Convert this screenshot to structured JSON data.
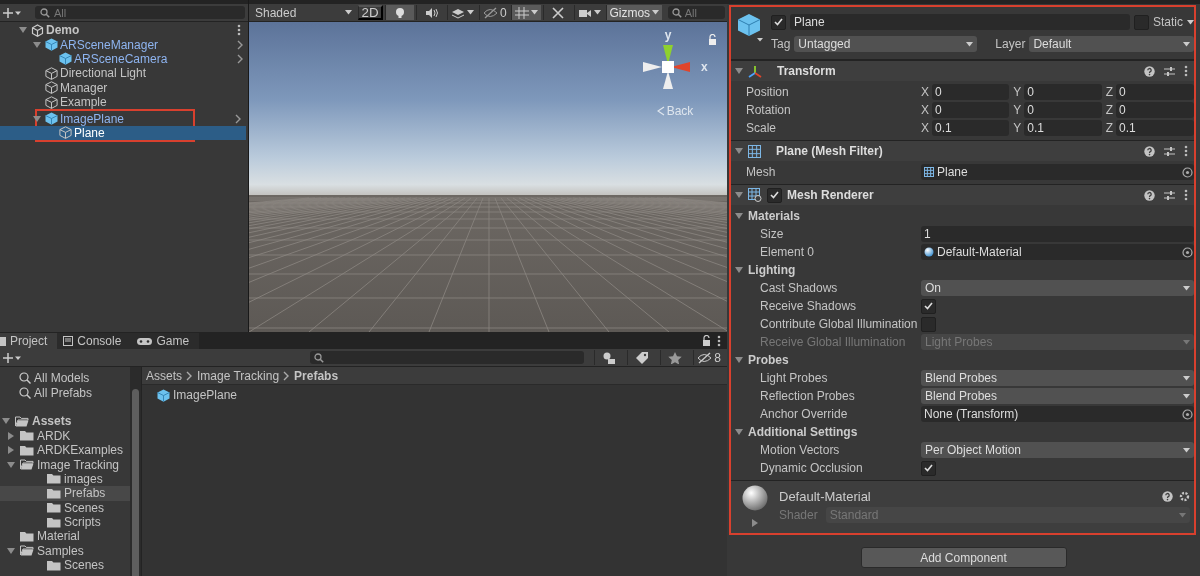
{
  "hierarchy": {
    "search_placeholder": "All",
    "items": [
      {
        "label": "Demo",
        "kind": "scene",
        "expanded": true,
        "selected": false,
        "highlighted": false,
        "children": [
          {
            "label": "ARSceneManager",
            "kind": "prefab",
            "expanded": true,
            "selected": false,
            "highlighted": false,
            "children": [
              {
                "label": "ARSceneCamera",
                "kind": "prefab",
                "selected": false,
                "highlighted": false
              }
            ]
          },
          {
            "label": "Directional Light",
            "kind": "object",
            "selected": false,
            "highlighted": false
          },
          {
            "label": "Manager",
            "kind": "object",
            "selected": false,
            "highlighted": false
          },
          {
            "label": "Example",
            "kind": "object",
            "selected": false,
            "highlighted": false
          },
          {
            "label": "ImagePlane",
            "kind": "prefab",
            "expanded": true,
            "selected": false,
            "highlighted": true,
            "children": [
              {
                "label": "Plane",
                "kind": "object",
                "selected": true,
                "highlighted": false
              }
            ]
          }
        ]
      }
    ]
  },
  "scene": {
    "toolbar": {
      "shading": "Shaded",
      "mode_2d": "2D",
      "lighting_on": true,
      "audio_on": false,
      "effects_on": false,
      "hidden_count": "0",
      "grid_on": true,
      "tools_on": false,
      "gizmos": "Gizmos",
      "search_placeholder": "All"
    },
    "gizmo": {
      "y_label": "y",
      "x_label": "x",
      "back_label": "Back"
    }
  },
  "project": {
    "tabs": [
      {
        "label": "Project",
        "kind": "project",
        "selected": true
      },
      {
        "label": "Console",
        "kind": "console",
        "selected": false
      },
      {
        "label": "Game",
        "kind": "game",
        "selected": false
      }
    ],
    "hidden_count": "8",
    "favorites": [
      "All Models",
      "All Prefabs"
    ],
    "folders": [
      {
        "label": "Assets",
        "expanded": true,
        "selected": false,
        "children": [
          {
            "label": "ARDK",
            "expanded": false,
            "selected": false
          },
          {
            "label": "ARDKExamples",
            "expanded": false,
            "selected": false
          },
          {
            "label": "Image Tracking",
            "expanded": true,
            "selected": false,
            "children": [
              {
                "label": "images",
                "selected": false
              },
              {
                "label": "Prefabs",
                "selected": true
              },
              {
                "label": "Scenes",
                "selected": false
              },
              {
                "label": "Scripts",
                "selected": false
              }
            ]
          },
          {
            "label": "Material",
            "selected": false
          },
          {
            "label": "Samples",
            "expanded": true,
            "selected": false,
            "children": [
              {
                "label": "Scenes",
                "selected": false
              }
            ]
          }
        ]
      }
    ],
    "breadcrumb": [
      "Assets",
      "Image Tracking",
      "Prefabs"
    ],
    "files": [
      {
        "label": "ImagePlane",
        "kind": "prefab"
      }
    ]
  },
  "inspector": {
    "highlighted": true,
    "object": {
      "active": true,
      "name": "Plane",
      "static": false,
      "static_label": "Static",
      "tag_label": "Tag",
      "tag": "Untagged",
      "layer_label": "Layer",
      "layer": "Default"
    },
    "components": [
      {
        "title": "Transform",
        "kind": "transform",
        "expanded": true,
        "properties": [
          {
            "label": "Position",
            "kind": "vector",
            "disabled": false,
            "axes": [
              {
                "axis": "X",
                "value": "0"
              },
              {
                "axis": "Y",
                "value": "0"
              },
              {
                "axis": "Z",
                "value": "0"
              }
            ]
          },
          {
            "label": "Rotation",
            "kind": "vector",
            "disabled": false,
            "axes": [
              {
                "axis": "X",
                "value": "0"
              },
              {
                "axis": "Y",
                "value": "0"
              },
              {
                "axis": "Z",
                "value": "0"
              }
            ]
          },
          {
            "label": "Scale",
            "kind": "vector",
            "disabled": false,
            "axes": [
              {
                "axis": "X",
                "value": "0.1"
              },
              {
                "axis": "Y",
                "value": "0.1"
              },
              {
                "axis": "Z",
                "value": "0.1"
              }
            ]
          }
        ]
      },
      {
        "title": "Plane (Mesh Filter)",
        "kind": "mesh_filter",
        "expanded": true,
        "properties": [
          {
            "label": "Mesh",
            "kind": "mesh_object",
            "value": "Plane",
            "disabled": false
          }
        ]
      },
      {
        "title": "Mesh Renderer",
        "kind": "mesh_renderer",
        "enabled": true,
        "expanded": true,
        "sections": [
          {
            "title": "Materials",
            "expanded": true,
            "properties": [
              {
                "label": "Size",
                "kind": "int",
                "value": "1",
                "disabled": false
              },
              {
                "label": "Element 0",
                "kind": "material_object",
                "value": "Default-Material",
                "disabled": false
              }
            ]
          },
          {
            "title": "Lighting",
            "expanded": true,
            "properties": [
              {
                "label": "Cast Shadows",
                "kind": "dropdown",
                "value": "On",
                "disabled": false
              },
              {
                "label": "Receive Shadows",
                "kind": "checkbox",
                "checked": true,
                "disabled": false
              },
              {
                "label": "Contribute Global Illumination",
                "kind": "checkbox",
                "checked": false,
                "disabled": false
              },
              {
                "label": "Receive Global Illumination",
                "kind": "dropdown",
                "value": "Light Probes",
                "disabled": true
              }
            ]
          },
          {
            "title": "Probes",
            "expanded": true,
            "properties": [
              {
                "label": "Light Probes",
                "kind": "dropdown",
                "value": "Blend Probes",
                "disabled": false
              },
              {
                "label": "Reflection Probes",
                "kind": "dropdown",
                "value": "Blend Probes",
                "disabled": false
              },
              {
                "label": "Anchor Override",
                "kind": "object",
                "value": "None (Transform)",
                "disabled": false
              }
            ]
          },
          {
            "title": "Additional Settings",
            "expanded": true,
            "properties": [
              {
                "label": "Motion Vectors",
                "kind": "dropdown",
                "value": "Per Object Motion",
                "disabled": false
              },
              {
                "label": "Dynamic Occlusion",
                "kind": "checkbox",
                "checked": true,
                "disabled": false
              }
            ]
          }
        ]
      }
    ],
    "material": {
      "name": "Default-Material",
      "expanded": false,
      "shader_label": "Shader",
      "shader": "Standard"
    },
    "add_component": "Add Component"
  }
}
